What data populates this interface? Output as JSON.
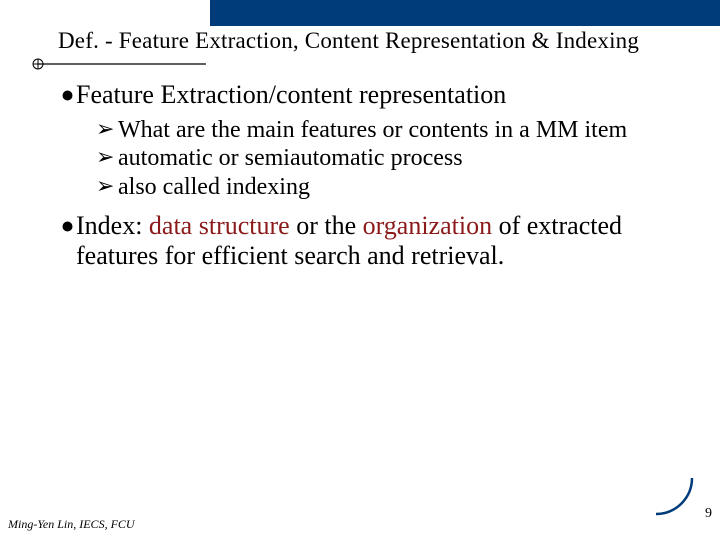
{
  "title": "Def. - Feature Extraction, Content Representation & Indexing",
  "bullets": {
    "b1": {
      "text": "Feature Extraction/content representation"
    },
    "b1_subs": {
      "s1": "What are the main features or contents in a MM item",
      "s2": "automatic or semiautomatic process",
      "s3": "also called indexing"
    },
    "b2": {
      "prefix": "Index: ",
      "accent1": "data structure",
      "mid": " or the ",
      "accent2": "organization",
      "suffix": " of extracted features for efficient search and retrieval."
    }
  },
  "footer": "Ming-Yen Lin, IECS, FCU",
  "page_number": "9"
}
